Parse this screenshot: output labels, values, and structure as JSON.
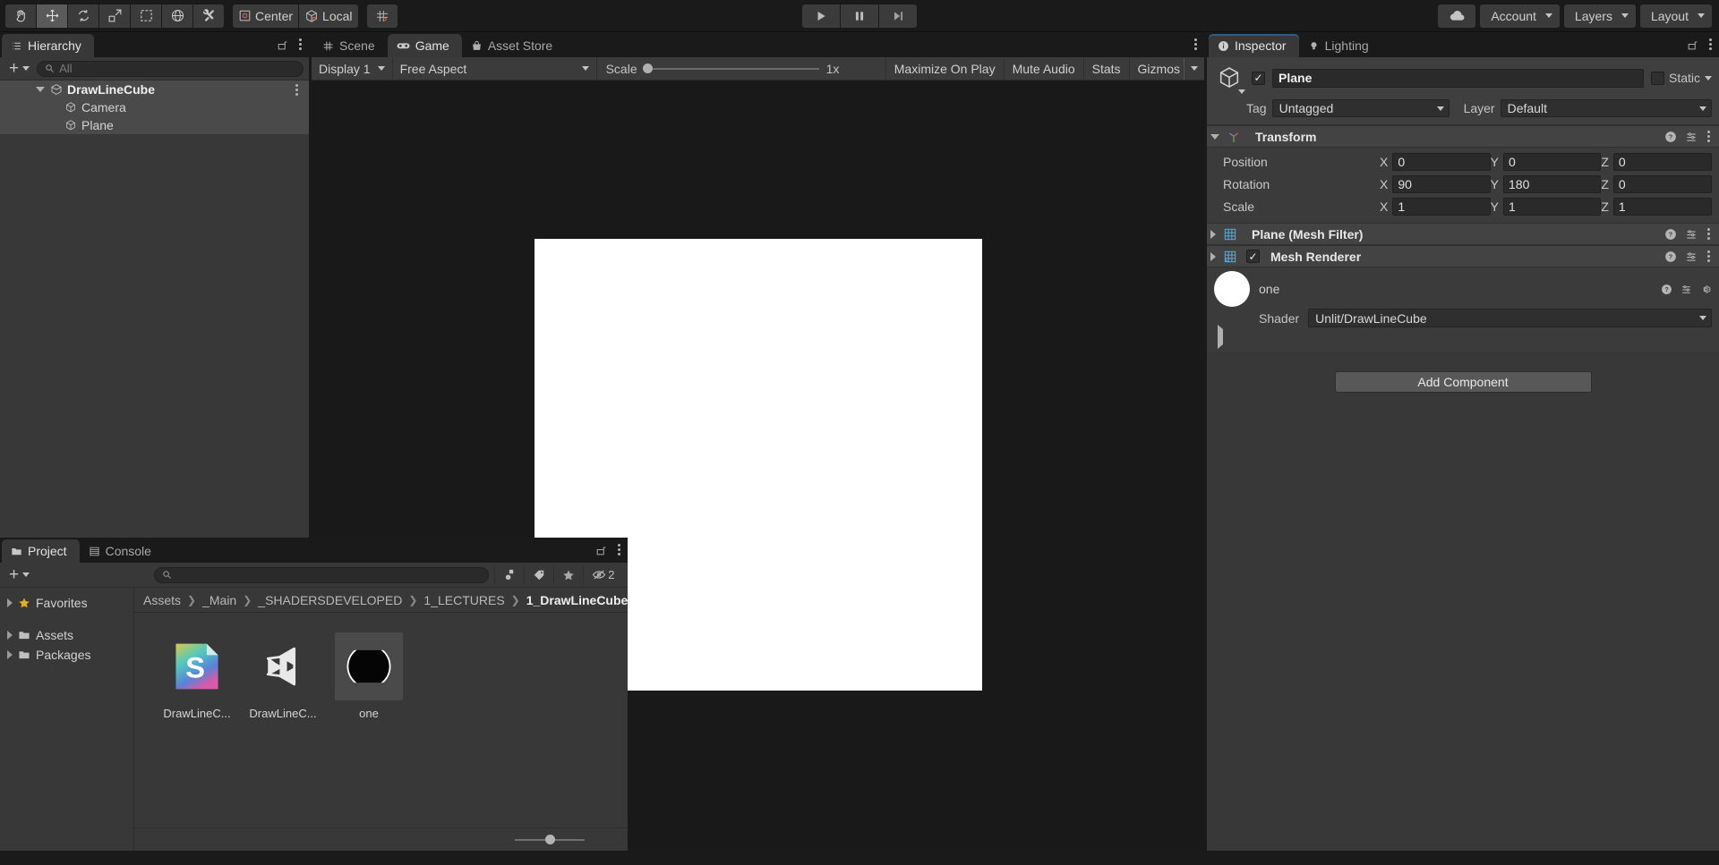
{
  "toolbar": {
    "tools": [
      {
        "name": "hand-tool",
        "icon": "hand-icon",
        "active": false
      },
      {
        "name": "move-tool",
        "icon": "move-icon",
        "active": true
      },
      {
        "name": "rotate-tool",
        "icon": "rotate-icon",
        "active": false
      },
      {
        "name": "scale-tool",
        "icon": "scale-icon",
        "active": false
      },
      {
        "name": "rect-tool",
        "icon": "rect-transform-icon",
        "active": false
      },
      {
        "name": "transform-tool",
        "icon": "transform-icon",
        "active": false
      },
      {
        "name": "custom-tool",
        "icon": "wrench-screwdriver-icon",
        "active": false
      }
    ],
    "pivot_label": "Center",
    "handle_label": "Local",
    "snap_label": "grid-snap-icon",
    "play_label": "play-icon",
    "pause_label": "pause-icon",
    "step_label": "step-icon",
    "cloud_label": "cloud-icon",
    "account_label": "Account",
    "layers_label": "Layers",
    "layout_label": "Layout"
  },
  "hierarchy": {
    "tab_label": "Hierarchy",
    "tab_icon": "hierarchy-icon",
    "add_label": "+",
    "search_placeholder": "All",
    "items": [
      {
        "label": "DrawLineCube",
        "icon": "scene-icon",
        "depth": 0,
        "selected": true,
        "expanded": true
      },
      {
        "label": "Camera",
        "icon": "gameobject-icon",
        "depth": 1,
        "selected": true,
        "expanded": false
      },
      {
        "label": "Plane",
        "icon": "gameobject-icon",
        "depth": 1,
        "selected": true,
        "expanded": false
      }
    ]
  },
  "gameview": {
    "tabs": [
      {
        "label": "Scene",
        "icon": "scene-grid-icon",
        "active": false
      },
      {
        "label": "Game",
        "icon": "gamepad-icon",
        "active": true
      },
      {
        "label": "Asset Store",
        "icon": "store-icon",
        "active": false
      }
    ],
    "display_label": "Display 1",
    "aspect_label": "Free Aspect",
    "scale_label": "Scale",
    "scale_value": "1x",
    "maximize_label": "Maximize On Play",
    "mute_label": "Mute Audio",
    "stats_label": "Stats",
    "gizmos_label": "Gizmos",
    "render_color": "#ffffff"
  },
  "project": {
    "tabs": [
      {
        "label": "Project",
        "icon": "folder-icon",
        "active": true
      },
      {
        "label": "Console",
        "icon": "console-icon",
        "active": false
      }
    ],
    "add_label": "+",
    "search_placeholder": "",
    "filter_count": "2",
    "tree": [
      {
        "label": "Favorites",
        "icon": "star-icon"
      },
      {
        "label": "Assets",
        "icon": "folder-icon"
      },
      {
        "label": "Packages",
        "icon": "folder-icon"
      }
    ],
    "breadcrumb": [
      "Assets",
      "_Main",
      "_SHADERSDEVELOPED",
      "1_LECTURES",
      "1_DrawLineCube"
    ],
    "assets": [
      {
        "label": "DrawLineC...",
        "icon": "shader-file-icon",
        "selected": false
      },
      {
        "label": "DrawLineC...",
        "icon": "unity-asset-icon",
        "selected": false
      },
      {
        "label": "one",
        "icon": "material-sphere-icon",
        "selected": true
      }
    ]
  },
  "inspector": {
    "tabs": [
      {
        "label": "Inspector",
        "icon": "info-icon",
        "active": true
      },
      {
        "label": "Lighting",
        "icon": "light-bulb-icon",
        "active": false
      }
    ],
    "object_name": "Plane",
    "object_enabled": true,
    "static_label": "Static",
    "tag_label": "Tag",
    "tag_value": "Untagged",
    "layer_label": "Layer",
    "layer_value": "Default",
    "transform": {
      "title": "Transform",
      "rows": [
        {
          "label": "Position",
          "x": "0",
          "y": "0",
          "z": "0"
        },
        {
          "label": "Rotation",
          "x": "90",
          "y": "180",
          "z": "0"
        },
        {
          "label": "Scale",
          "x": "1",
          "y": "1",
          "z": "1"
        }
      ],
      "axis_labels": [
        "X",
        "Y",
        "Z"
      ]
    },
    "mesh_filter": {
      "title": "Plane (Mesh Filter)"
    },
    "mesh_renderer": {
      "title": "Mesh Renderer",
      "enabled": true
    },
    "material": {
      "name": "one",
      "preview_color": "#ffffff",
      "shader_label": "Shader",
      "shader_value": "Unlit/DrawLineCube"
    },
    "add_component_label": "Add Component"
  }
}
